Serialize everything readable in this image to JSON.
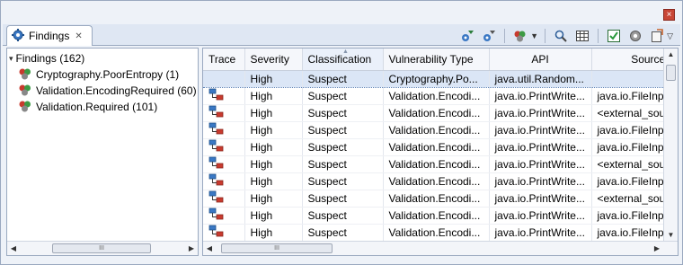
{
  "window": {
    "close_glyph": "×"
  },
  "tab": {
    "label": "Findings",
    "close_glyph": "✕"
  },
  "toolbar": {
    "icons": [
      "filter-gear-icon",
      "filter-gear-alt-icon",
      "bug-dropdown-icon",
      "search-icon",
      "table-columns-icon",
      "checklist-icon",
      "settings-gear-icon",
      "export-icon",
      "view-menu-icon"
    ]
  },
  "tree": {
    "root": "Findings (162)",
    "items": [
      {
        "label": "Cryptography.PoorEntropy (1)"
      },
      {
        "label": "Validation.EncodingRequired (60)"
      },
      {
        "label": "Validation.Required (101)"
      }
    ],
    "scroll_grip": "III"
  },
  "table": {
    "columns": [
      "Trace",
      "Severity",
      "Classification",
      "Vulnerability Type",
      "API",
      "Source"
    ],
    "sorted_column": "Classification",
    "rows": [
      {
        "severity": "High",
        "classification": "Suspect",
        "vuln": "Cryptography.Po...",
        "api": "java.util.Random...",
        "source": "",
        "trace": false,
        "selected": true
      },
      {
        "severity": "High",
        "classification": "Suspect",
        "vuln": "Validation.Encodi...",
        "api": "java.io.PrintWrite...",
        "source": "java.io.FileInp",
        "trace": true
      },
      {
        "severity": "High",
        "classification": "Suspect",
        "vuln": "Validation.Encodi...",
        "api": "java.io.PrintWrite...",
        "source": "<external_sou",
        "trace": true
      },
      {
        "severity": "High",
        "classification": "Suspect",
        "vuln": "Validation.Encodi...",
        "api": "java.io.PrintWrite...",
        "source": "java.io.FileInp",
        "trace": true
      },
      {
        "severity": "High",
        "classification": "Suspect",
        "vuln": "Validation.Encodi...",
        "api": "java.io.PrintWrite...",
        "source": "java.io.FileInp",
        "trace": true
      },
      {
        "severity": "High",
        "classification": "Suspect",
        "vuln": "Validation.Encodi...",
        "api": "java.io.PrintWrite...",
        "source": "<external_sou",
        "trace": true
      },
      {
        "severity": "High",
        "classification": "Suspect",
        "vuln": "Validation.Encodi...",
        "api": "java.io.PrintWrite...",
        "source": "java.io.FileInp",
        "trace": true
      },
      {
        "severity": "High",
        "classification": "Suspect",
        "vuln": "Validation.Encodi...",
        "api": "java.io.PrintWrite...",
        "source": "<external_sou",
        "trace": true
      },
      {
        "severity": "High",
        "classification": "Suspect",
        "vuln": "Validation.Encodi...",
        "api": "java.io.PrintWrite...",
        "source": "java.io.FileInp",
        "trace": true
      },
      {
        "severity": "High",
        "classification": "Suspect",
        "vuln": "Validation.Encodi...",
        "api": "java.io.PrintWrite...",
        "source": "java.io.FileInp",
        "trace": true
      }
    ],
    "scroll_grip": "III"
  },
  "colors": {
    "accent": "#2f6fb8",
    "frame": "#9aa9c0",
    "selection": "#dbe6f6"
  }
}
